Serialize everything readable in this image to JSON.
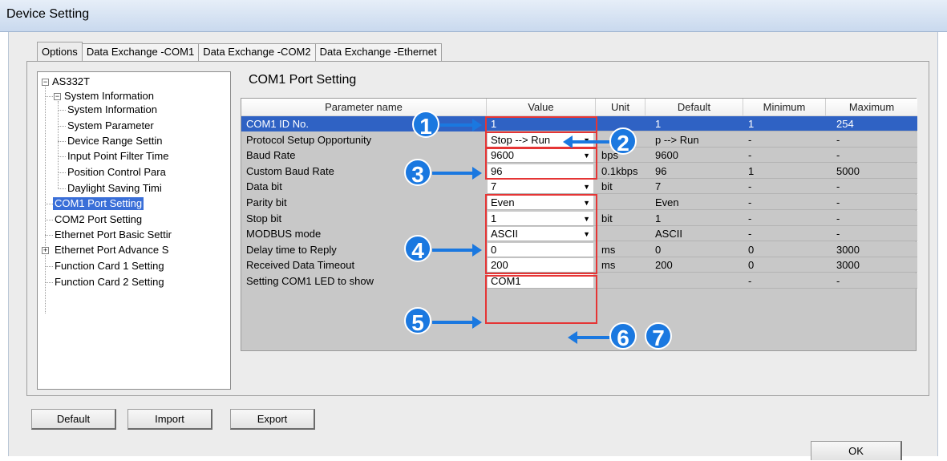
{
  "window": {
    "title": "Device Setting"
  },
  "tabs": [
    {
      "label": "Options"
    },
    {
      "label": "Data Exchange -COM1"
    },
    {
      "label": "Data Exchange -COM2"
    },
    {
      "label": "Data Exchange -Ethernet"
    }
  ],
  "tree": {
    "root": "AS332T",
    "sys_info": "System Information",
    "sys_children": [
      "System Information",
      "System Parameter",
      "Device Range Settin",
      "Input Point Filter Time",
      "Position Control Para",
      "Daylight Saving Timi"
    ],
    "items": [
      "COM1 Port Setting",
      "COM2 Port Setting",
      "Ethernet Port Basic Settir",
      "Ethernet Port Advance S",
      "Function Card 1 Setting",
      "Function Card 2 Setting"
    ]
  },
  "section": {
    "title": "COM1 Port Setting"
  },
  "grid": {
    "headers": [
      "Parameter name",
      "Value",
      "Unit",
      "Default",
      "Minimum",
      "Maximum"
    ],
    "rows": [
      {
        "name": "COM1 ID No.",
        "value": "1",
        "unit": "",
        "default": "1",
        "min": "1",
        "max": "254"
      },
      {
        "name": "Protocol Setup Opportunity",
        "value": "Stop --> Run",
        "unit": "",
        "default": "p --> Run",
        "min": "-",
        "max": "-"
      },
      {
        "name": "Baud Rate",
        "value": "9600",
        "unit": "bps",
        "default": "9600",
        "min": "-",
        "max": "-"
      },
      {
        "name": "Custom Baud Rate",
        "value": "96",
        "unit": "0.1kbps",
        "default": "96",
        "min": "1",
        "max": "5000"
      },
      {
        "name": "Data bit",
        "value": "7",
        "unit": "bit",
        "default": "7",
        "min": "-",
        "max": "-"
      },
      {
        "name": "Parity bit",
        "value": "Even",
        "unit": "",
        "default": "Even",
        "min": "-",
        "max": "-"
      },
      {
        "name": "Stop bit",
        "value": "1",
        "unit": "bit",
        "default": "1",
        "min": "-",
        "max": "-"
      },
      {
        "name": "MODBUS mode",
        "value": "ASCII",
        "unit": "",
        "default": "ASCII",
        "min": "-",
        "max": "-"
      },
      {
        "name": "Delay time to Reply",
        "value": "0",
        "unit": "ms",
        "default": "0",
        "min": "0",
        "max": "3000"
      },
      {
        "name": "Received Data Timeout",
        "value": "200",
        "unit": "ms",
        "default": "200",
        "min": "0",
        "max": "3000"
      },
      {
        "name": "Setting COM1 LED to show",
        "value": "COM1",
        "unit": "",
        "default": "",
        "min": "-",
        "max": "-"
      }
    ]
  },
  "callouts": [
    "1",
    "2",
    "3",
    "4",
    "5",
    "6",
    "7"
  ],
  "buttons": {
    "default": "Default",
    "import": "Import",
    "export": "Export",
    "ok": "OK"
  },
  "colors": {
    "callout": "#1a78e0",
    "highlight": "#e53535",
    "selection": "#2f62c4"
  }
}
